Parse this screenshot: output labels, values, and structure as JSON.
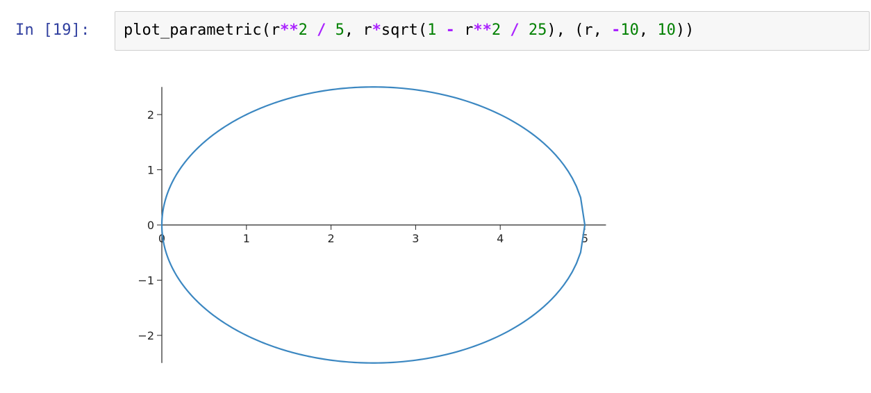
{
  "cell": {
    "prompt": "In [19]:",
    "code_tokens": [
      {
        "t": "plot_parametric(r",
        "c": "name"
      },
      {
        "t": "**",
        "c": "op"
      },
      {
        "t": "2",
        "c": "num"
      },
      {
        "t": " ",
        "c": "name"
      },
      {
        "t": "/",
        "c": "op"
      },
      {
        "t": " ",
        "c": "name"
      },
      {
        "t": "5",
        "c": "num"
      },
      {
        "t": ", r",
        "c": "name"
      },
      {
        "t": "*",
        "c": "op"
      },
      {
        "t": "sqrt(",
        "c": "name"
      },
      {
        "t": "1",
        "c": "num"
      },
      {
        "t": " ",
        "c": "name"
      },
      {
        "t": "-",
        "c": "op"
      },
      {
        "t": " r",
        "c": "name"
      },
      {
        "t": "**",
        "c": "op"
      },
      {
        "t": "2",
        "c": "num"
      },
      {
        "t": " ",
        "c": "name"
      },
      {
        "t": "/",
        "c": "op"
      },
      {
        "t": " ",
        "c": "name"
      },
      {
        "t": "25",
        "c": "num"
      },
      {
        "t": "), (r, ",
        "c": "name"
      },
      {
        "t": "-",
        "c": "op"
      },
      {
        "t": "10",
        "c": "num"
      },
      {
        "t": ", ",
        "c": "name"
      },
      {
        "t": "10",
        "c": "num"
      },
      {
        "t": "))",
        "c": "name"
      }
    ]
  },
  "colors": {
    "prompt": "#303f9f",
    "operator": "#aa22ff",
    "number": "#008000",
    "curve": "#3b87c1",
    "axis": "#262626"
  },
  "chart_data": {
    "type": "line",
    "title": "",
    "xlabel": "",
    "ylabel": "",
    "xlim": [
      0,
      5.25
    ],
    "ylim": [
      -2.5,
      2.5
    ],
    "x_ticks": [
      0,
      1,
      2,
      3,
      4,
      5
    ],
    "x_tick_labels": [
      "0",
      "1",
      "2",
      "3",
      "4",
      "5"
    ],
    "y_ticks": [
      -2,
      -1,
      0,
      1,
      2
    ],
    "y_tick_labels": [
      "−2",
      "−1",
      "0",
      "1",
      "2"
    ],
    "grid": false,
    "legend": "none",
    "spines": "centered-at-origin",
    "series": [
      {
        "parametric": {
          "x": "r**2 / 5",
          "y": "r*sqrt(1 - r**2 / 25)",
          "param": "r",
          "range": [
            -10,
            10
          ]
        },
        "description_visible": "ellipse through (0,0) and (5,0), y from -2.5 to 2.5"
      }
    ]
  }
}
